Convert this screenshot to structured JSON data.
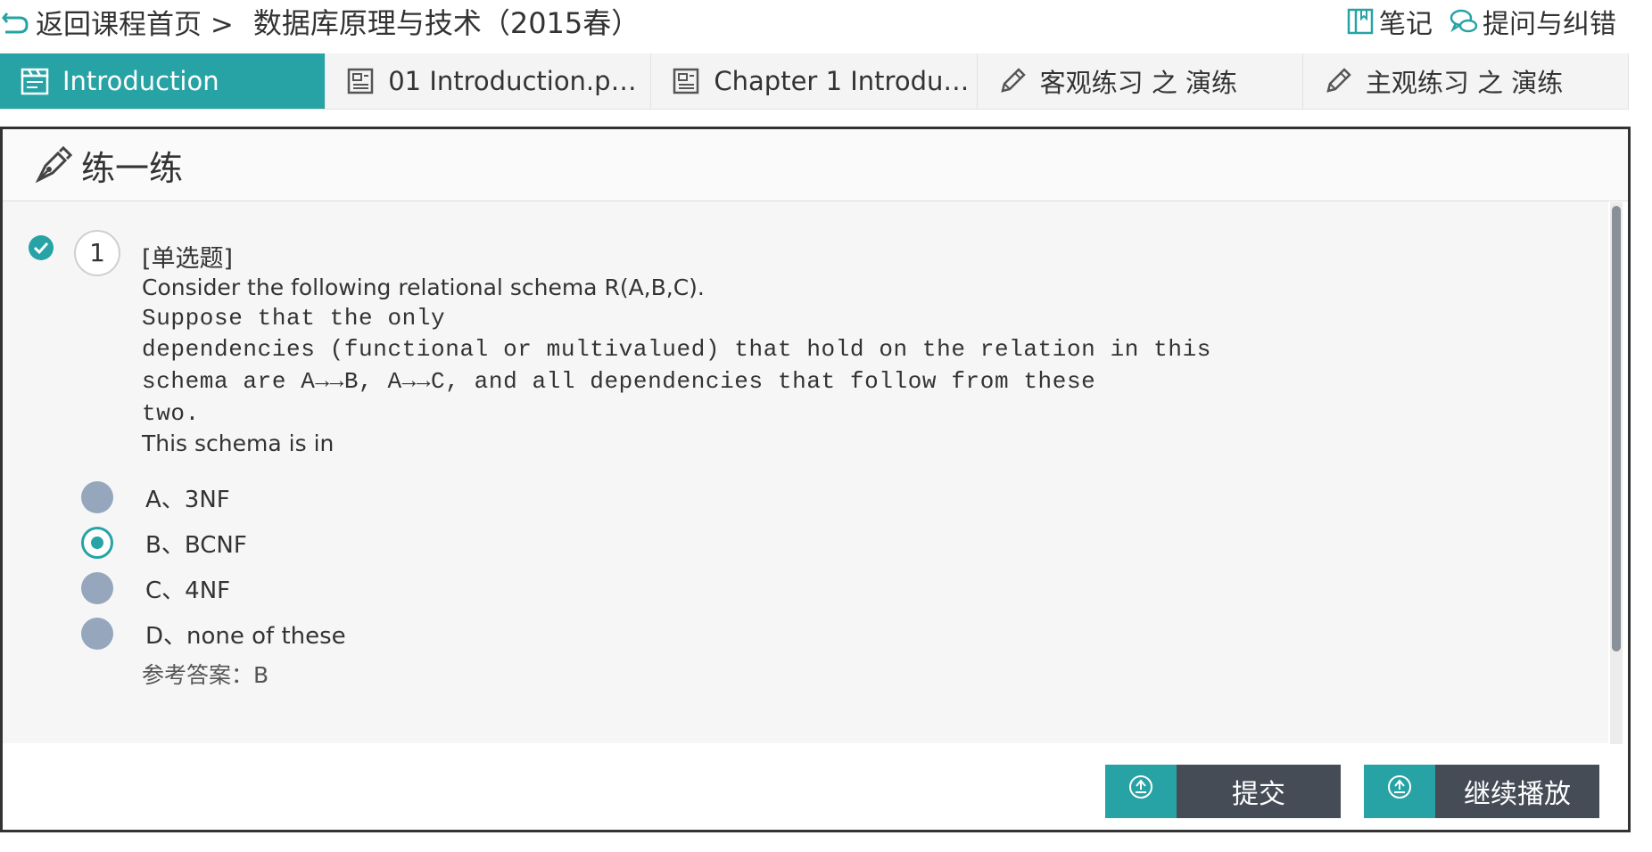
{
  "topbar": {
    "back_label": "返回课程首页 >",
    "course_title": "数据库原理与技术（2015春）",
    "notes_label": "笔记",
    "feedback_label": "提问与纠错"
  },
  "tabs": [
    {
      "label": "Introduction",
      "active": true,
      "icon": "clapperboard-icon"
    },
    {
      "label": "01 Introduction.pptx",
      "active": false,
      "icon": "document-icon"
    },
    {
      "label": "Chapter 1 Introductio...",
      "active": false,
      "icon": "document-icon"
    },
    {
      "label": "客观练习 之 演练",
      "active": false,
      "icon": "pencil-icon"
    },
    {
      "label": "主观练习 之 演练",
      "active": false,
      "icon": "pencil-icon"
    }
  ],
  "panel": {
    "title": "练一练",
    "question": {
      "number": "1",
      "type": "[单选题]",
      "line1": "Consider the following relational schema R(A,B,C).",
      "mono_line1": "Suppose that the only",
      "mono_line2": "dependencies (functional or multivalued) that hold on the relation in this",
      "mono_line3": "schema are A→→B, A→→C, and all dependencies that follow from these",
      "mono_line4": "two.",
      "line_last": "This schema is in"
    },
    "options": [
      {
        "label": "A、3NF",
        "selected": false
      },
      {
        "label": "B、BCNF",
        "selected": true
      },
      {
        "label": "C、4NF",
        "selected": false
      },
      {
        "label": "D、none of these",
        "selected": false
      }
    ],
    "answer_partial": "参考答案：B"
  },
  "buttons": {
    "submit_label": "提交",
    "continue_label": "继续播放"
  },
  "colors": {
    "accent": "#27a3a5",
    "button_dark": "#454c56",
    "radio_unselected": "#95a6bd"
  }
}
